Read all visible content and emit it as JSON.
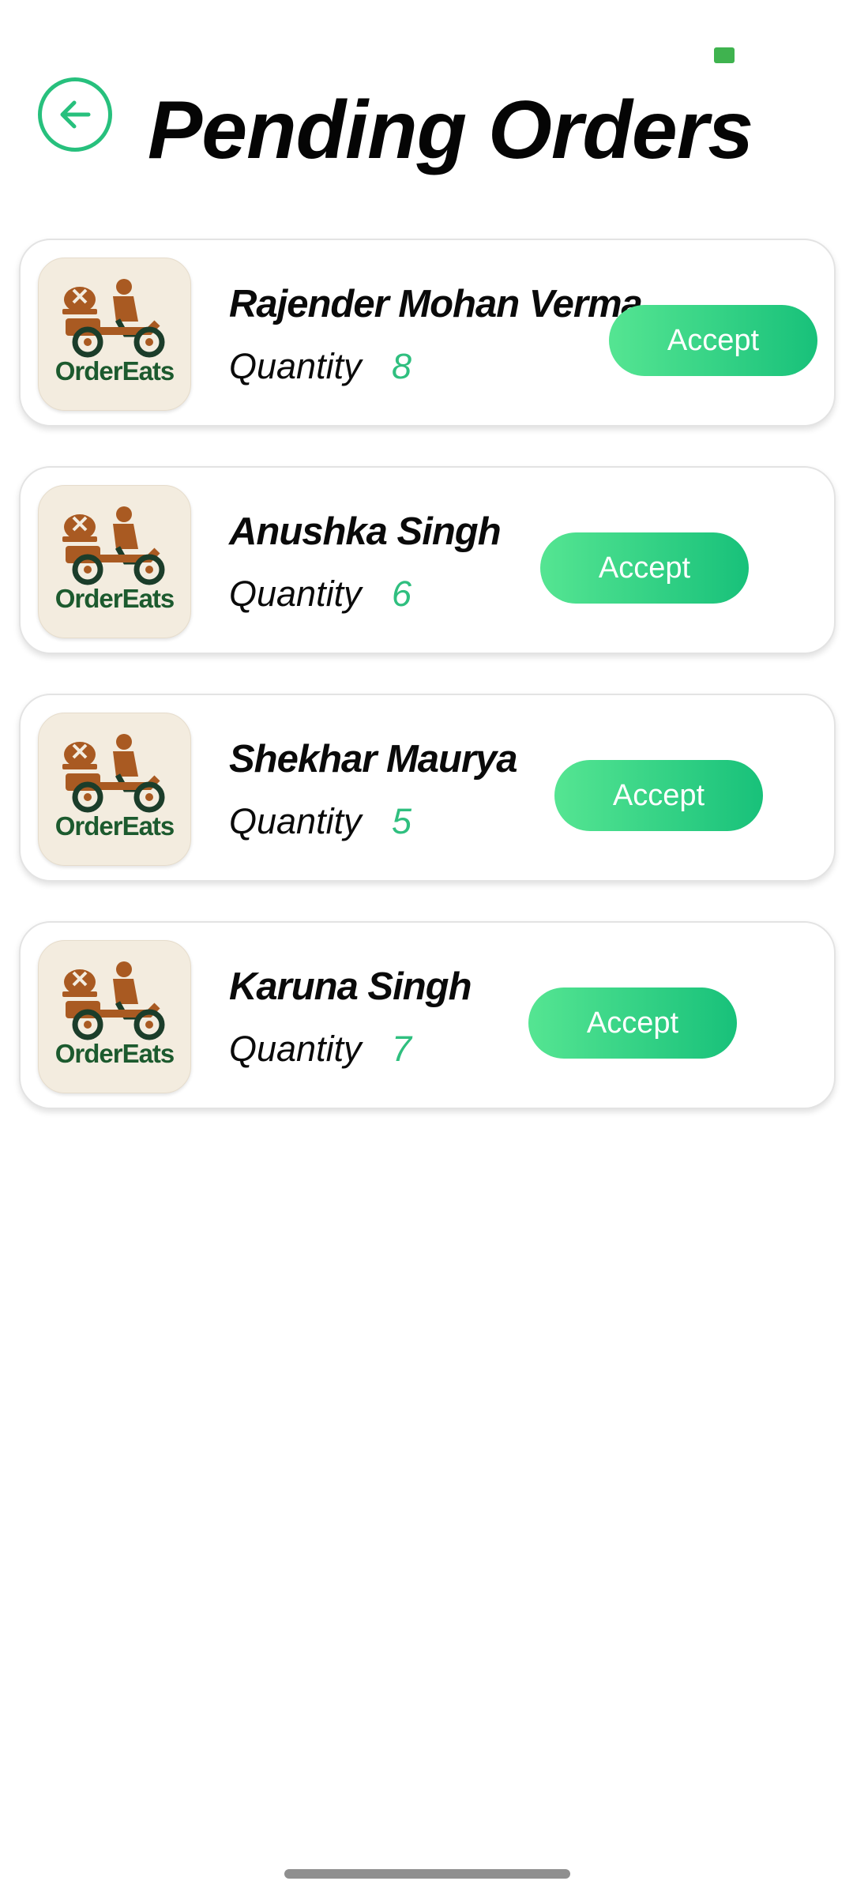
{
  "header": {
    "title": "Pending Orders",
    "back_icon": "arrow-left-icon",
    "accent_color": "#27c07d"
  },
  "logo": {
    "brand": "OrderEats",
    "icon": "delivery-scooter-icon"
  },
  "orders": [
    {
      "name": "Rajender Mohan Verma",
      "quantity_label": "Quantity",
      "quantity": "8",
      "button_label": "Accept"
    },
    {
      "name": "Anushka Singh",
      "quantity_label": "Quantity",
      "quantity": "6",
      "button_label": "Accept"
    },
    {
      "name": "Shekhar Maurya",
      "quantity_label": "Quantity",
      "quantity": "5",
      "button_label": "Accept"
    },
    {
      "name": "Karuna Singh",
      "quantity_label": "Quantity",
      "quantity": "7",
      "button_label": "Accept"
    }
  ]
}
